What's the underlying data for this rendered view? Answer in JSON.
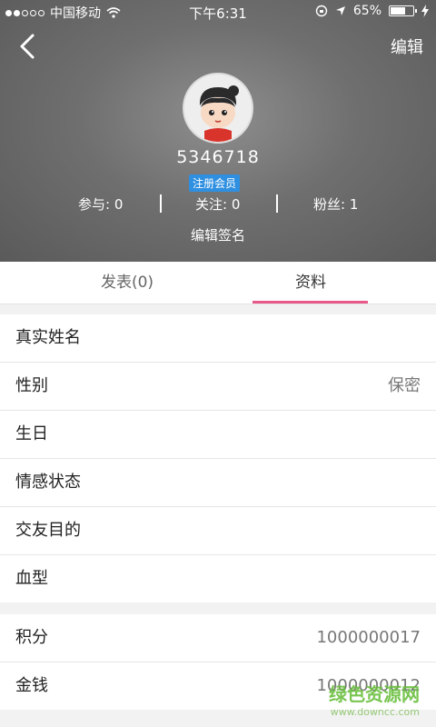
{
  "status_bar": {
    "carrier": "中国移动",
    "time": "下午6:31",
    "battery": "65%"
  },
  "header": {
    "edit_label": "编辑",
    "username": "5346718",
    "member_badge": "注册会员",
    "stats": [
      {
        "label": "参与",
        "value": "0",
        "text": "参与: 0"
      },
      {
        "label": "关注",
        "value": "0",
        "text": "关注: 0"
      },
      {
        "label": "粉丝",
        "value": "1",
        "text": "粉丝: 1"
      }
    ],
    "signature_label": "编辑签名"
  },
  "tabs": [
    {
      "label": "发表(0)",
      "active": false
    },
    {
      "label": "资料",
      "active": true
    }
  ],
  "profile_fields": [
    {
      "label": "真实姓名",
      "value": ""
    },
    {
      "label": "性别",
      "value": "保密"
    },
    {
      "label": "生日",
      "value": ""
    },
    {
      "label": "情感状态",
      "value": ""
    },
    {
      "label": "交友目的",
      "value": ""
    },
    {
      "label": "血型",
      "value": ""
    }
  ],
  "account_fields": [
    {
      "label": "积分",
      "value": "1000000017"
    },
    {
      "label": "金钱",
      "value": "1000000012"
    }
  ],
  "watermark": {
    "text": "绿色资源网",
    "sub": "www.downcc.com"
  },
  "colors": {
    "tab_indicator": "#e9598a",
    "badge": "#2f8fe0"
  }
}
